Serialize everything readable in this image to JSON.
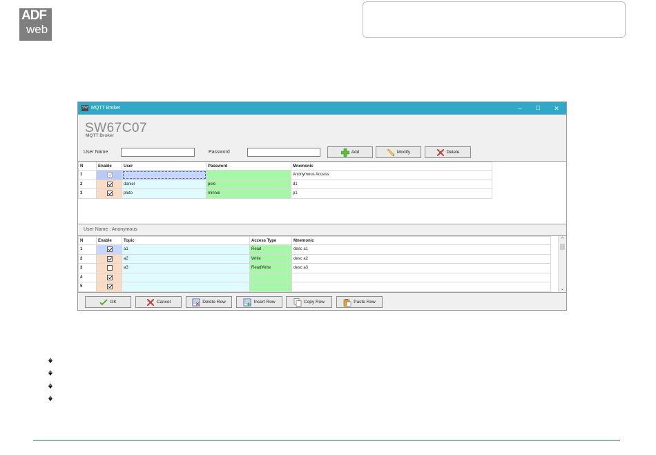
{
  "logo": {
    "line1": "ADF",
    "line2": "web"
  },
  "window": {
    "title": "MQTT Broker",
    "controls": {
      "minimize": "–",
      "maximize": "☐",
      "close": "✕"
    },
    "app_title": "SW67C07",
    "app_subtitle": "MQTT Broker"
  },
  "form": {
    "user_name_label": "User Name",
    "user_name_value": "",
    "password_label": "Password",
    "password_value": "",
    "add_label": "Add",
    "modify_label": "Modify",
    "delete_label": "Delete"
  },
  "users_table": {
    "columns": [
      "N",
      "Enable",
      "User",
      "Password",
      "Mnemonic"
    ],
    "rows": [
      {
        "n": "1",
        "enabled": true,
        "user": "",
        "password": "",
        "mnemonic": "Anonymous Access"
      },
      {
        "n": "2",
        "enabled": true,
        "user": "daniel",
        "password": "pole",
        "mnemonic": "d1"
      },
      {
        "n": "3",
        "enabled": true,
        "user": "pluto",
        "password": "minnie",
        "mnemonic": "p1"
      }
    ]
  },
  "user_caption": "User Name : Anonymous",
  "topics_table": {
    "columns": [
      "N",
      "Enable",
      "Topic",
      "Access Type",
      "Mnemonic"
    ],
    "rows": [
      {
        "n": "1",
        "enabled": true,
        "topic": "a1",
        "access": "Read",
        "mnemonic": "desc a1"
      },
      {
        "n": "2",
        "enabled": true,
        "topic": "a2",
        "access": "Write",
        "mnemonic": "desc a2"
      },
      {
        "n": "3",
        "enabled": false,
        "topic": "a3",
        "access": "ReadWrite",
        "mnemonic": "desc a3"
      },
      {
        "n": "4",
        "enabled": true,
        "topic": "",
        "access": "",
        "mnemonic": ""
      },
      {
        "n": "5",
        "enabled": true,
        "topic": "",
        "access": "",
        "mnemonic": ""
      }
    ]
  },
  "bottom_buttons": {
    "ok": "OK",
    "cancel": "Cancel",
    "delete_row": "Delete Row",
    "insert_row": "Insert Row",
    "copy_row": "Copy Row",
    "paste_row": "Paste Row"
  },
  "colors": {
    "titlebar": "#33a7c7",
    "enable_cell": "#fadcc4",
    "user_cell": "#e0fbfd",
    "password_cell": "#a8f7a8",
    "footer_line": "#2b6f5e"
  }
}
